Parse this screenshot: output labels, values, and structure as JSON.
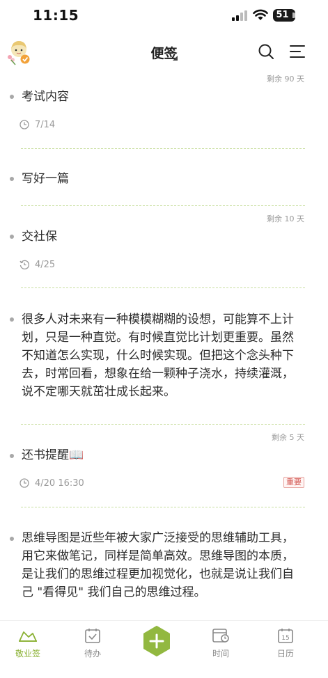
{
  "status": {
    "time": "11:15",
    "battery": "51"
  },
  "header": {
    "title": "便签"
  },
  "notes": [
    {
      "remaining": "剩余 90 天",
      "text": "考试内容",
      "date": "7/14"
    },
    {
      "text": "写好一篇"
    },
    {
      "remaining": "剩余 10 天",
      "text": "交社保",
      "date": "4/25"
    },
    {
      "text": "很多人对未来有一种模模糊糊的设想，可能算不上计划，只是一种直觉。有时候直觉比计划更重要。虽然不知道怎么实现，什么时候实现。但把这个念头种下去，时常回看，想象在给一颗种子浇水，持续灌溉，说不定哪天就茁壮成长起来。"
    },
    {
      "remaining": "剩余 5 天",
      "text": "还书提醒📖",
      "date": "4/20 16:30",
      "tag": "重要"
    },
    {
      "text": "思维导图是近些年被大家广泛接受的思维辅助工具，用它来做笔记，同样是简单高效。思维导图的本质，是让我们的思维过程更加视觉化，也就是说让我们自己 \"看得见\" 我们自己的思维过程。"
    }
  ],
  "tabbar": {
    "items": [
      {
        "label": "敬业签",
        "icon": "sign-icon",
        "active": true
      },
      {
        "label": "待办",
        "icon": "todo-icon"
      },
      {
        "label": "",
        "icon": "add-icon"
      },
      {
        "label": "时间",
        "icon": "time-icon"
      },
      {
        "label": "日历",
        "icon": "calendar-icon",
        "day": "15"
      }
    ]
  },
  "colors": {
    "accent": "#8cb236",
    "tag": "#d0504a",
    "divider": "#c9dfa0"
  }
}
